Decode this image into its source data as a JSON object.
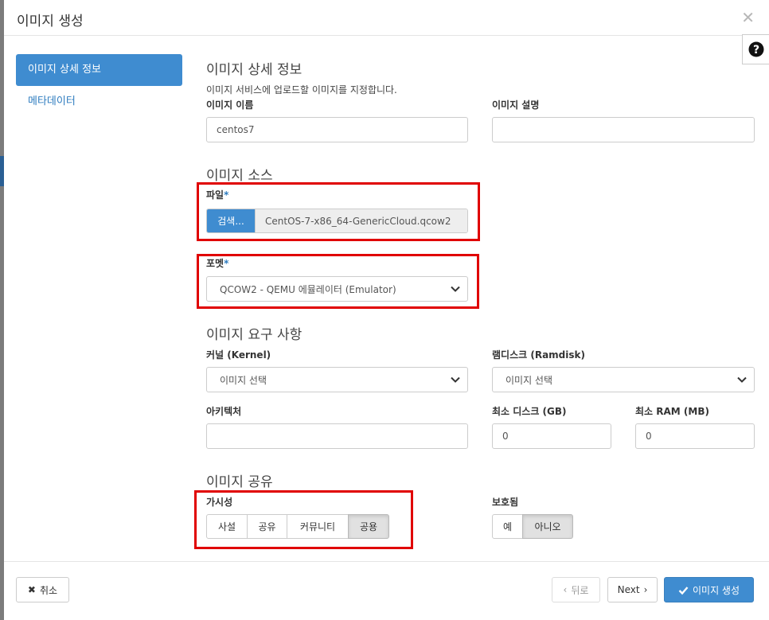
{
  "modal": {
    "title": "이미지 생성"
  },
  "sidebar": {
    "items": [
      {
        "label": "이미지 상세 정보"
      },
      {
        "label": "메타데이터"
      }
    ]
  },
  "details": {
    "heading": "이미지 상세 정보",
    "description": "이미지 서비스에 업로드할 이미지를 지정합니다.",
    "name_label": "이미지 이름",
    "name_value": "centos7",
    "desc_label": "이미지 설명",
    "desc_value": ""
  },
  "source": {
    "heading": "이미지 소스",
    "file_label": "파일",
    "browse_label": "검색...",
    "file_name": "CentOS-7-x86_64-GenericCloud.qcow2",
    "format_label": "포멧",
    "format_value": "QCOW2 - QEMU 에뮬레이터 (Emulator)",
    "required_mark": "*"
  },
  "requirements": {
    "heading": "이미지 요구 사항",
    "kernel_label": "커널 (Kernel)",
    "kernel_value": "이미지 선택",
    "ramdisk_label": "램디스크 (Ramdisk)",
    "ramdisk_value": "이미지 선택",
    "arch_label": "아키텍처",
    "arch_value": "",
    "min_disk_label": "최소 디스크 (GB)",
    "min_disk_value": "0",
    "min_ram_label": "최소 RAM (MB)",
    "min_ram_value": "0"
  },
  "sharing": {
    "heading": "이미지 공유",
    "visibility_label": "가시성",
    "visibility_options": [
      "사설",
      "공유",
      "커뮤니티",
      "공용"
    ],
    "visibility_selected": "공용",
    "protected_label": "보호됨",
    "protected_options": [
      "예",
      "아니오"
    ],
    "protected_selected": "아니오"
  },
  "footer": {
    "cancel_label": "취소",
    "back_label": "뒤로",
    "next_label": "Next",
    "create_label": "이미지 생성"
  },
  "colors": {
    "accent": "#3f8cd0",
    "highlight": "#e00000"
  }
}
